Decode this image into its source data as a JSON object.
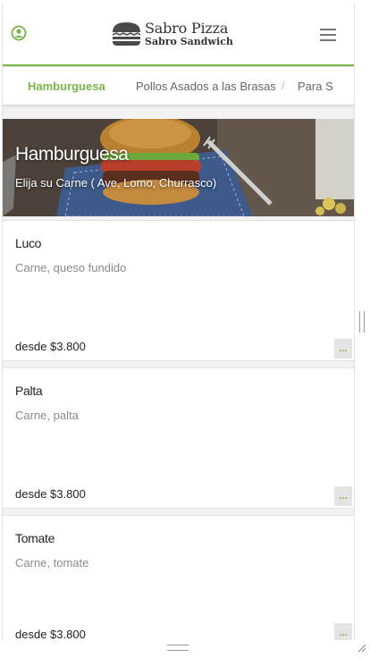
{
  "header": {
    "brand_line1": "Sabro Pizza",
    "brand_line2": "Sabro Sandwich",
    "user_icon": "user-circle-icon",
    "menu_icon": "hamburger-menu-icon",
    "accent_color": "#7ab547"
  },
  "tabs": [
    {
      "label": "Hamburguesa",
      "active": true
    },
    {
      "label": "Pollos Asados a las Brasas",
      "active": false
    },
    {
      "label": "Para S",
      "active": false
    }
  ],
  "tab_separator": "/",
  "banner": {
    "title": "Hamburguesa",
    "subtitle": "Elija su Carne ( Ave, Lomo, Churrasco)"
  },
  "items": [
    {
      "name": "Luco",
      "description": "Carne, queso fundido",
      "price": "desde $3.800",
      "more": "..."
    },
    {
      "name": "Palta",
      "description": "Carne, palta",
      "price": "desde $3.800",
      "more": "..."
    },
    {
      "name": "Tomate",
      "description": "Carne, tomate",
      "price": "desde $3.800",
      "more": "..."
    }
  ]
}
